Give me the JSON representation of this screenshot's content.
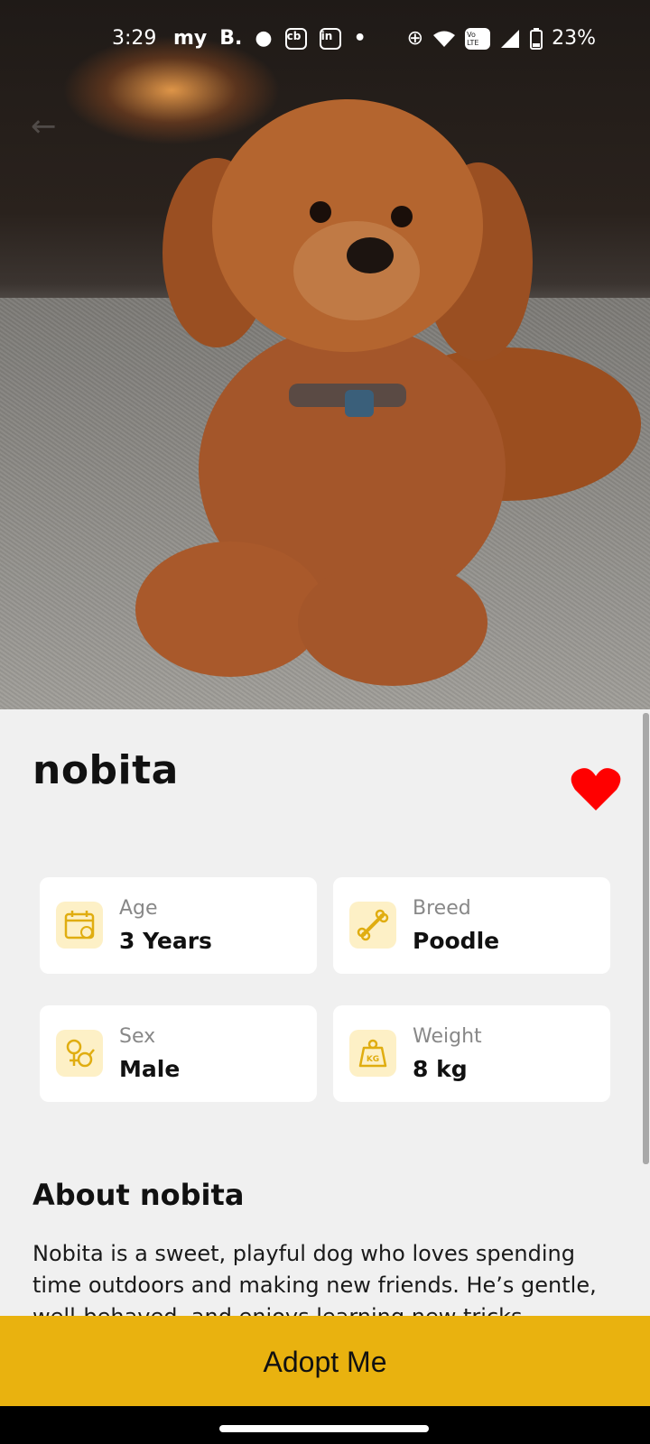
{
  "status_bar": {
    "time": "3:29",
    "app_icons": [
      "my",
      "B.",
      "reddit",
      "cb",
      "in",
      "•"
    ],
    "battery": "23%",
    "network": "Vo LTE"
  },
  "pet": {
    "name": "nobita",
    "favorited": true
  },
  "info_cards": [
    {
      "label": "Age",
      "value": "3 Years",
      "icon": "calendar-icon"
    },
    {
      "label": "Breed",
      "value": "Poodle",
      "icon": "bone-icon"
    },
    {
      "label": "Sex",
      "value": "Male",
      "icon": "gender-icon"
    },
    {
      "label": "Weight",
      "value": "8 kg",
      "icon": "weight-icon"
    }
  ],
  "about": {
    "title": "About nobita",
    "text": "Nobita is a sweet, playful dog who loves spending time outdoors and making new friends. He’s gentle, well-behaved, and enjoys learning new tricks."
  },
  "adopt_label": "Adopt Me",
  "colors": {
    "accent": "#e9b20f",
    "icon_bg": "#fdf0c6",
    "icon_fg": "#e0ad10",
    "heart": "#ff0000"
  }
}
